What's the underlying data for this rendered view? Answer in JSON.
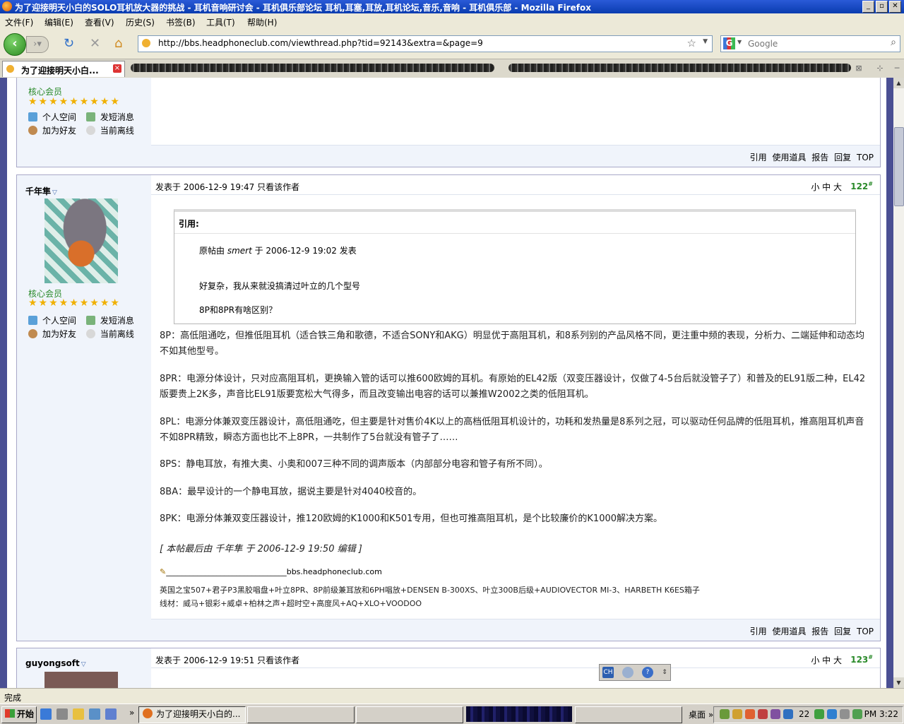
{
  "window": {
    "title": "为了迎接明天小白的SOLO耳机放大器的挑战 - 耳机音响研讨会 - 耳机俱乐部论坛 耳机,耳塞,耳放,耳机论坛,音乐,音响 - 耳机俱乐部 - Mozilla Firefox",
    "min": "_",
    "max": "▫",
    "close": "✕"
  },
  "menu": [
    "文件(F)",
    "编辑(E)",
    "查看(V)",
    "历史(S)",
    "书签(B)",
    "工具(T)",
    "帮助(H)"
  ],
  "nav": {
    "url": "http://bbs.headphoneclub.com/viewthread.php?tid=92143&extra=&page=9",
    "search_placeholder": "Google"
  },
  "tabs": {
    "active_label": "为了迎接明天小白...",
    "active_close": "×"
  },
  "post_prev": {
    "rank": "核心会员",
    "stars": "★★★★★★★★★",
    "links": [
      "个人空间",
      "发短消息",
      "加为好友",
      "当前离线"
    ],
    "footer": [
      "引用",
      "使用道具",
      "报告",
      "回复",
      "TOP"
    ]
  },
  "post_main": {
    "author": "千年隼",
    "rank": "核心会员",
    "stars": "★★★★★★★★★",
    "links": [
      "个人空间",
      "发短消息",
      "加为好友",
      "当前离线"
    ],
    "posted": "发表于 2006-12-9 19:47  只看该作者",
    "sizes": "小  中  大",
    "floor": "122",
    "floor_sup": "#",
    "quote": {
      "header": "引用:",
      "origin_prefix": "原帖由 ",
      "origin_user": "smert",
      "origin_suffix": " 于 2006-12-9 19:02 发表",
      "line1": "好复杂，我从来就没搞清过叶立的几个型号",
      "line2": "8P和8PR有啥区别？"
    },
    "paragraphs": [
      "8P：高低阻通吃，但推低阻耳机（适合铁三角和歌德，不适合SONY和AKG）明显优于高阻耳机，和8系列别的产品风格不同，更注重中频的表现，分析力、二端延伸和动态均不如其他型号。",
      "8PR：电源分体设计，只对应高阻耳机，更换输入管的话可以推600欧姆的耳机。有原始的EL42版（双变压器设计，仅做了4-5台后就没管子了）和普及的EL91版二种，EL42版要贵上2K多，声音比EL91版要宽松大气得多，而且改变输出电容的话可以兼推W2002之类的低阻耳机。",
      "8PL：电源分体兼双变压器设计，高低阻通吃，但主要是针对售价4K以上的高档低阻耳机设计的，功耗和发热量是8系列之冠，可以驱动任何品牌的低阻耳机，推高阻耳机声音不如8PR精致，瞬态方面也比不上8PR，一共制作了5台就没有管子了……",
      "8PS：静电耳放，有推大奥、小奥和007三种不同的调声版本（内部部分电容和管子有所不同）。",
      "8BA：最早设计的一个静电耳放，据说主要是针对4040校音的。",
      "8PK：电源分体兼双变压器设计，推120欧姆的K1000和K501专用，但也可推高阻耳机，是个比较廉价的K1000解决方案。"
    ],
    "edit_note": "[ 本帖最后由 千年隼 于 2006-12-9 19:50 编辑 ]",
    "sig_rule": "_______________________________bbs.headphoneclub.com",
    "sig1": "英国之宝507+君子P3黑胶唱盘+叶立8PR、8P前级兼耳放和6PH唱放+DENSEN B-300XS、叶立300B后级+AUDIOVECTOR MI-3、HARBETH K6ES箱子",
    "sig2": "线材：威马+银彩+威卓+柏林之声+超时空+高度风+AQ+XLO+VOODOO",
    "footer": [
      "引用",
      "使用道具",
      "报告",
      "回复",
      "TOP"
    ]
  },
  "post_next": {
    "author": "guyongsoft",
    "posted": "发表于 2006-12-9 19:51  只看该作者",
    "sizes": "小  中  大",
    "floor": "123",
    "floor_sup": "#"
  },
  "ime": {
    "lang": "CH",
    "help": "?"
  },
  "status": "完成",
  "taskbar": {
    "start": "开始",
    "task_firefox": "为了迎接明天小白的...",
    "desktop": "桌面",
    "tray_num": "22",
    "clock": "PM 3:22"
  }
}
